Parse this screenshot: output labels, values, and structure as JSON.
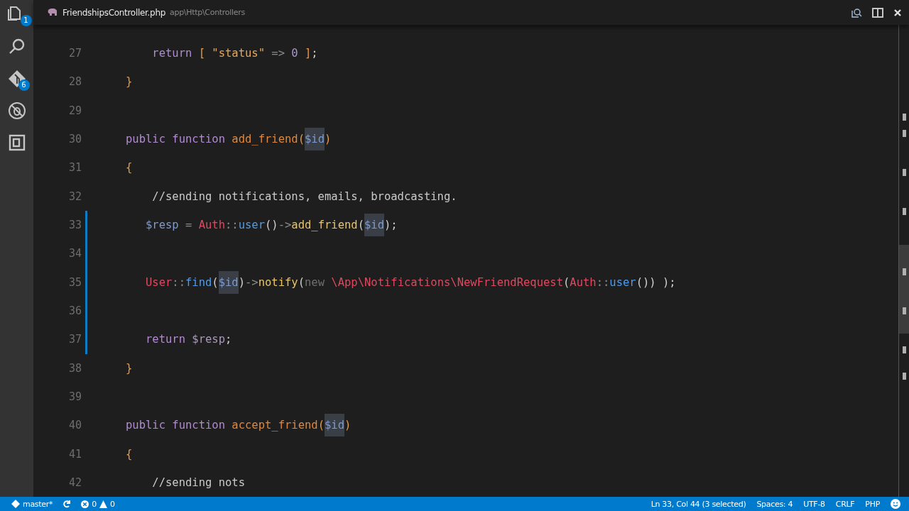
{
  "activity_bar": {
    "files_badge": "1",
    "git_badge": "6"
  },
  "tab": {
    "filename": "FriendshipsController.php",
    "path": "app\\Http\\Controllers"
  },
  "lines": [
    {
      "number": "27",
      "modified": false,
      "code": [
        {
          "text": "    return",
          "kind": "kw"
        },
        {
          "text": " [",
          "kind": "brace"
        },
        {
          "text": " \"status\"",
          "kind": "str"
        },
        {
          "text": " => ",
          "kind": "op"
        },
        {
          "text": "0",
          "kind": "num"
        },
        {
          "text": " ]",
          "kind": "brace"
        },
        {
          "text": ";",
          "kind": "plain"
        }
      ]
    },
    {
      "number": "28",
      "modified": false,
      "code": [
        {
          "text": "}",
          "kind": "brace"
        }
      ]
    },
    {
      "number": "29",
      "modified": false
    },
    {
      "number": "30",
      "modified": false,
      "code": [
        {
          "text": "public",
          "kind": "kw"
        },
        {
          "text": " function",
          "kind": "kw"
        },
        {
          "text": " add_friend",
          "kind": "fn"
        },
        {
          "text": "(",
          "kind": "brace"
        },
        {
          "text": "$id",
          "kind": "match"
        },
        {
          "text": ")",
          "kind": "brace"
        }
      ]
    },
    {
      "number": "31",
      "modified": false,
      "code": [
        {
          "text": "{",
          "kind": "brace"
        }
      ]
    },
    {
      "number": "32",
      "modified": false,
      "code": [
        {
          "text": "    //sending notifications, emails, broadcasting.",
          "kind": "comment"
        }
      ]
    },
    {
      "number": "33",
      "modified": true,
      "code": [
        {
          "text": "   $resp",
          "kind": "var"
        },
        {
          "text": " = ",
          "kind": "op"
        },
        {
          "text": "Auth",
          "kind": "cls"
        },
        {
          "text": "::",
          "kind": "op"
        },
        {
          "text": "user",
          "kind": "call"
        },
        {
          "text": "()",
          "kind": "plain"
        },
        {
          "text": "->",
          "kind": "op"
        },
        {
          "text": "add_friend",
          "kind": "method"
        },
        {
          "text": "(",
          "kind": "plain"
        },
        {
          "text": "$id",
          "kind": "match"
        },
        {
          "text": ");",
          "kind": "plain"
        }
      ]
    },
    {
      "number": "34",
      "modified": true
    },
    {
      "number": "35",
      "modified": true,
      "code": [
        {
          "text": "   User",
          "kind": "cls"
        },
        {
          "text": "::",
          "kind": "op"
        },
        {
          "text": "find",
          "kind": "call"
        },
        {
          "text": "(",
          "kind": "plain"
        },
        {
          "text": "$id",
          "kind": "match"
        },
        {
          "text": ")",
          "kind": "plain"
        },
        {
          "text": "->",
          "kind": "op"
        },
        {
          "text": "notify",
          "kind": "method"
        },
        {
          "text": "(",
          "kind": "plain"
        },
        {
          "text": "new",
          "kind": "new"
        },
        {
          "text": " \\App\\Notifications\\NewFriendRequest",
          "kind": "cls"
        },
        {
          "text": "(",
          "kind": "plain"
        },
        {
          "text": "Auth",
          "kind": "cls"
        },
        {
          "text": "::",
          "kind": "op"
        },
        {
          "text": "user",
          "kind": "call"
        },
        {
          "text": "()) );",
          "kind": "plain"
        }
      ]
    },
    {
      "number": "36",
      "modified": true
    },
    {
      "number": "37",
      "modified": true,
      "code": [
        {
          "text": "   return",
          "kind": "kw"
        },
        {
          "text": " $resp",
          "kind": "var2"
        },
        {
          "text": ";",
          "kind": "plain"
        }
      ]
    },
    {
      "number": "38",
      "modified": false,
      "code": [
        {
          "text": "}",
          "kind": "brace"
        }
      ]
    },
    {
      "number": "39",
      "modified": false
    },
    {
      "number": "40",
      "modified": false,
      "code": [
        {
          "text": "public",
          "kind": "kw"
        },
        {
          "text": " function",
          "kind": "kw"
        },
        {
          "text": " accept_friend",
          "kind": "fn"
        },
        {
          "text": "(",
          "kind": "brace"
        },
        {
          "text": "$id",
          "kind": "match"
        },
        {
          "text": ")",
          "kind": "brace"
        }
      ]
    },
    {
      "number": "41",
      "modified": false,
      "code": [
        {
          "text": "{",
          "kind": "brace"
        }
      ]
    },
    {
      "number": "42",
      "modified": false,
      "code": [
        {
          "text": "    //sending nots",
          "kind": "comment"
        }
      ]
    }
  ],
  "status_bar": {
    "branch": "master*",
    "errors": "0",
    "warnings": "0",
    "position": "Ln 33, Col 44 (3 selected)",
    "indentation": "Spaces: 4",
    "encoding": "UTF-8",
    "line_ending": "CRLF",
    "language": "PHP"
  }
}
